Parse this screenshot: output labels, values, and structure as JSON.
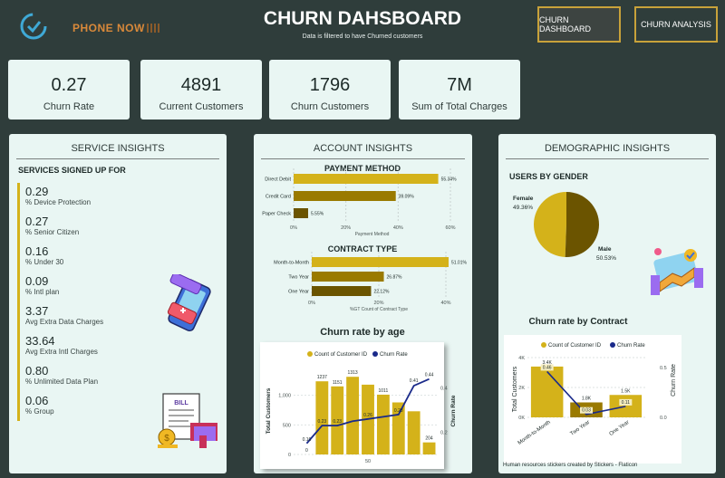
{
  "header": {
    "brand": "PHONE NOW",
    "title": "CHURN DAHSBOARD",
    "subtitle": "Data is filtered to have Churned customers",
    "nav": [
      "CHURN DASHBOARD",
      "CHURN ANALYSIS"
    ]
  },
  "kpis": [
    {
      "value": "0.27",
      "label": "Churn Rate"
    },
    {
      "value": "4891",
      "label": "Current Customers"
    },
    {
      "value": "1796",
      "label": "Churn Customers"
    },
    {
      "value": "7M",
      "label": "Sum of Total Charges"
    }
  ],
  "service": {
    "heading": "SERVICE INSIGHTS",
    "subheading": "SERVICES SIGNED UP FOR",
    "items": [
      {
        "value": "0.29",
        "label": "% Device Protection"
      },
      {
        "value": "0.27",
        "label": "% Senior Citizen"
      },
      {
        "value": "0.16",
        "label": "% Under 30"
      },
      {
        "value": "0.09",
        "label": "% Intl plan"
      },
      {
        "value": "3.37",
        "label": "Avg Extra Data Charges"
      },
      {
        "value": "33.64",
        "label": "Avg Extra Intl Charges"
      },
      {
        "value": "0.80",
        "label": "% Unlimited Data Plan"
      },
      {
        "value": "0.06",
        "label": "% Group"
      }
    ],
    "sticker_text": "BILL"
  },
  "account": {
    "heading": "ACCOUNT INSIGHTS"
  },
  "demographic": {
    "heading": "DEMOGRAPHIC INSIGHTS"
  },
  "credit": "Human resources stickers created by Stickers - Flaticon",
  "colors": {
    "gold": "#d4b21a",
    "dark_gold": "#9a7a00",
    "olive": "#6b5400",
    "navy": "#1a2a8a",
    "panel": "#e9f6f3",
    "bg": "#2f3d3b"
  },
  "chart_data": [
    {
      "type": "bar",
      "orientation": "horizontal",
      "title": "PAYMENT METHOD",
      "categories": [
        "Direct Debit",
        "Credit Card",
        "Paper Check"
      ],
      "values": [
        55.34,
        39.09,
        5.55
      ],
      "value_labels": [
        "55.34%",
        "39.09%",
        "5.55%"
      ],
      "xlabel": "Payment Method",
      "xticks": [
        "0%",
        "20%",
        "40%",
        "60%"
      ],
      "xlim": [
        0,
        60
      ]
    },
    {
      "type": "bar",
      "orientation": "horizontal",
      "title": "CONTRACT TYPE",
      "categories": [
        "Month-to-Month",
        "Two Year",
        "One Year"
      ],
      "values": [
        51.01,
        26.87,
        22.12
      ],
      "value_labels": [
        "51.01%",
        "26.87%",
        "22.12%"
      ],
      "xlabel": "%GT Count of Contract Type",
      "xticks": [
        "0%",
        "20%",
        "40%"
      ],
      "xlim": [
        0,
        50
      ]
    },
    {
      "type": "bar",
      "title": "Churn rate by age",
      "legend": [
        "Count of Customer ID",
        "Churn Rate"
      ],
      "ylabel": "Total Customers",
      "y2label": "Churn Rate",
      "bar_labels": [
        "0",
        "1237",
        "1151",
        "1313",
        "",
        "1011",
        "",
        "",
        "204"
      ],
      "bars": [
        0,
        1237,
        1151,
        1313,
        1180,
        1011,
        880,
        730,
        204
      ],
      "line": [
        0.15,
        0.23,
        0.23,
        0.25,
        0.26,
        0.27,
        0.28,
        0.41,
        0.44
      ],
      "line_labels": [
        "0.16",
        "0.23",
        "0.23",
        "",
        "0.26",
        "",
        "0.28",
        "0.41",
        "0.44"
      ],
      "yticks": [
        "0",
        "500",
        "1,000"
      ],
      "y2ticks": [
        "0.2",
        "0.4"
      ],
      "xticks": [
        "50"
      ],
      "ylim": [
        0,
        1500
      ],
      "y2lim": [
        0.1,
        0.5
      ]
    },
    {
      "type": "pie",
      "title": "USERS BY GENDER",
      "slices": [
        {
          "label": "Female",
          "value": 49.36,
          "value_label": "49.36%"
        },
        {
          "label": "Male",
          "value": 50.53,
          "value_label": "50.53%"
        }
      ]
    },
    {
      "type": "bar",
      "title": "Churn rate by Contract",
      "legend": [
        "Count of Customer ID",
        "Churn Rate"
      ],
      "categories": [
        "Month-to-Month",
        "Two Year",
        "One Year"
      ],
      "bars": [
        3400,
        1000,
        1500
      ],
      "bar_labels": [
        "3.4K",
        "1.8K",
        "1.5K"
      ],
      "line": [
        0.46,
        0.03,
        0.11
      ],
      "line_labels": [
        "0.46",
        "0.03",
        "0.11"
      ],
      "ylabel": "Total Customers",
      "y2label": "Churn Rate",
      "yticks": [
        "0K",
        "2K",
        "4K"
      ],
      "y2ticks": [
        "0.0",
        "0.5"
      ],
      "ylim": [
        0,
        4000
      ],
      "y2lim": [
        0,
        0.6
      ]
    }
  ]
}
